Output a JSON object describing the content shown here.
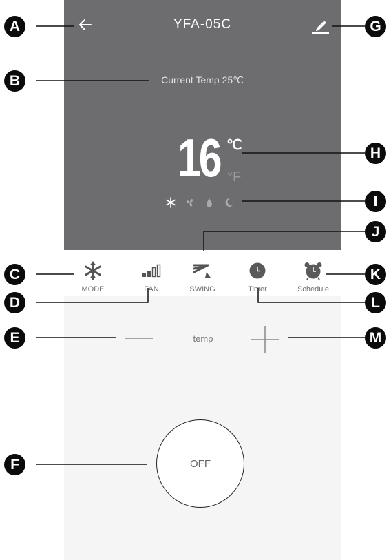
{
  "header": {
    "title": "YFA-05C",
    "back_icon": "arrow-left-icon",
    "edit_icon": "pencil-icon"
  },
  "status": {
    "current_temp": "Current Temp 25℃"
  },
  "setpoint": {
    "value": "16",
    "unit_c": "℃",
    "unit_f": "°F"
  },
  "mode_indicators": [
    "snowflake-icon",
    "fan-icon",
    "drop-icon",
    "moon-icon"
  ],
  "controls": [
    {
      "label": "MODE",
      "icon": "snowflake-icon"
    },
    {
      "label": "FAN",
      "icon": "signal-bars-icon"
    },
    {
      "label": "SWING",
      "icon": "swing-icon"
    },
    {
      "label": "Timer",
      "icon": "clock-icon"
    },
    {
      "label": "Schedule",
      "icon": "alarm-clock-icon"
    }
  ],
  "temp_control": {
    "label": "temp",
    "minus_icon": "minus-icon",
    "plus_icon": "plus-icon"
  },
  "power": {
    "label": "OFF"
  },
  "callouts": [
    "A",
    "B",
    "C",
    "D",
    "E",
    "F",
    "G",
    "H",
    "I",
    "J",
    "K",
    "L",
    "M"
  ],
  "colors": {
    "screen_bg": "#6d6d6f",
    "panel_bg": "#f4f5f4",
    "callout": "#0b0b0b"
  }
}
